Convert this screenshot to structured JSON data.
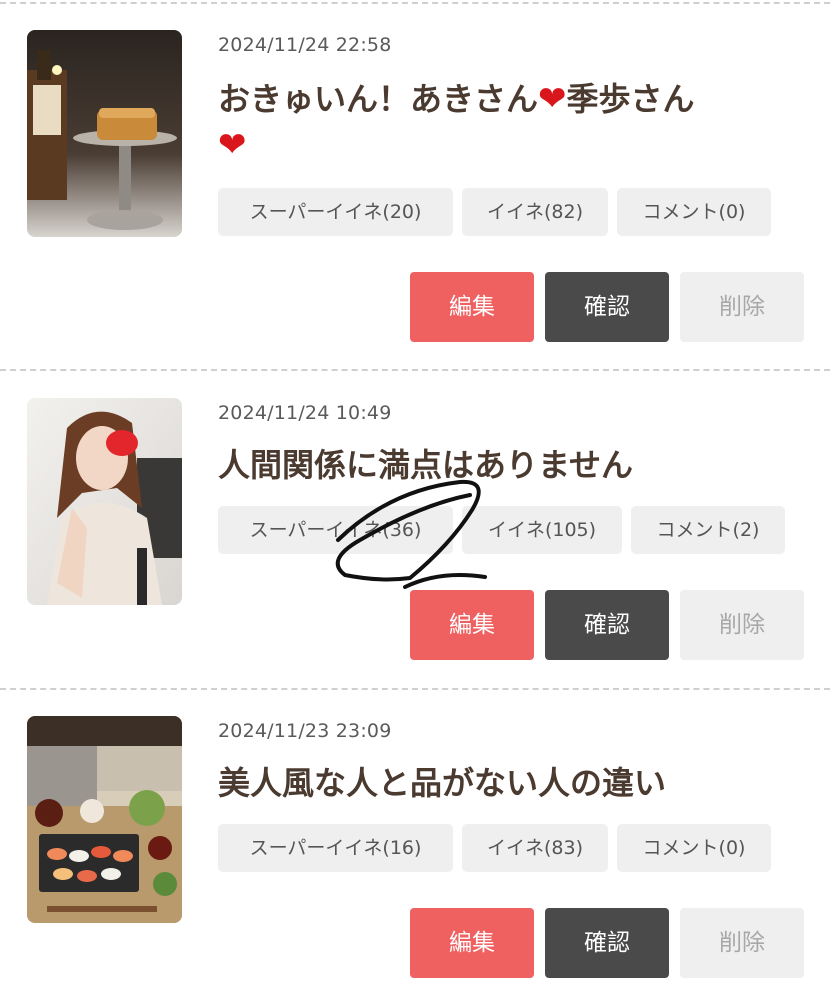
{
  "posts": [
    {
      "date": "2024/11/24 22:58",
      "title_part1": "おきゅいん！あきさん",
      "title_part2": "季歩さん",
      "heart": "❤",
      "super_like": "スーパーイイネ(20)",
      "like": "イイネ(82)",
      "comment": "コメント(0)",
      "edit": "編集",
      "confirm": "確認",
      "delete": "削除"
    },
    {
      "date": "2024/11/24 10:49",
      "title": "人間関係に満点はありません",
      "super_like": "スーパーイイネ(36)",
      "like": "イイネ(105)",
      "comment": "コメント(2)",
      "edit": "編集",
      "confirm": "確認",
      "delete": "削除"
    },
    {
      "date": "2024/11/23 23:09",
      "title": "美人風な人と品がない人の違い",
      "super_like": "スーパーイイネ(16)",
      "like": "イイネ(83)",
      "comment": "コメント(0)",
      "edit": "編集",
      "confirm": "確認",
      "delete": "削除"
    }
  ],
  "colors": {
    "edit_button": "#ef6060",
    "confirm_button": "#4a4a4a",
    "delete_button": "#efefef",
    "title_text": "#4a3a30",
    "heart": "#d9161c"
  }
}
